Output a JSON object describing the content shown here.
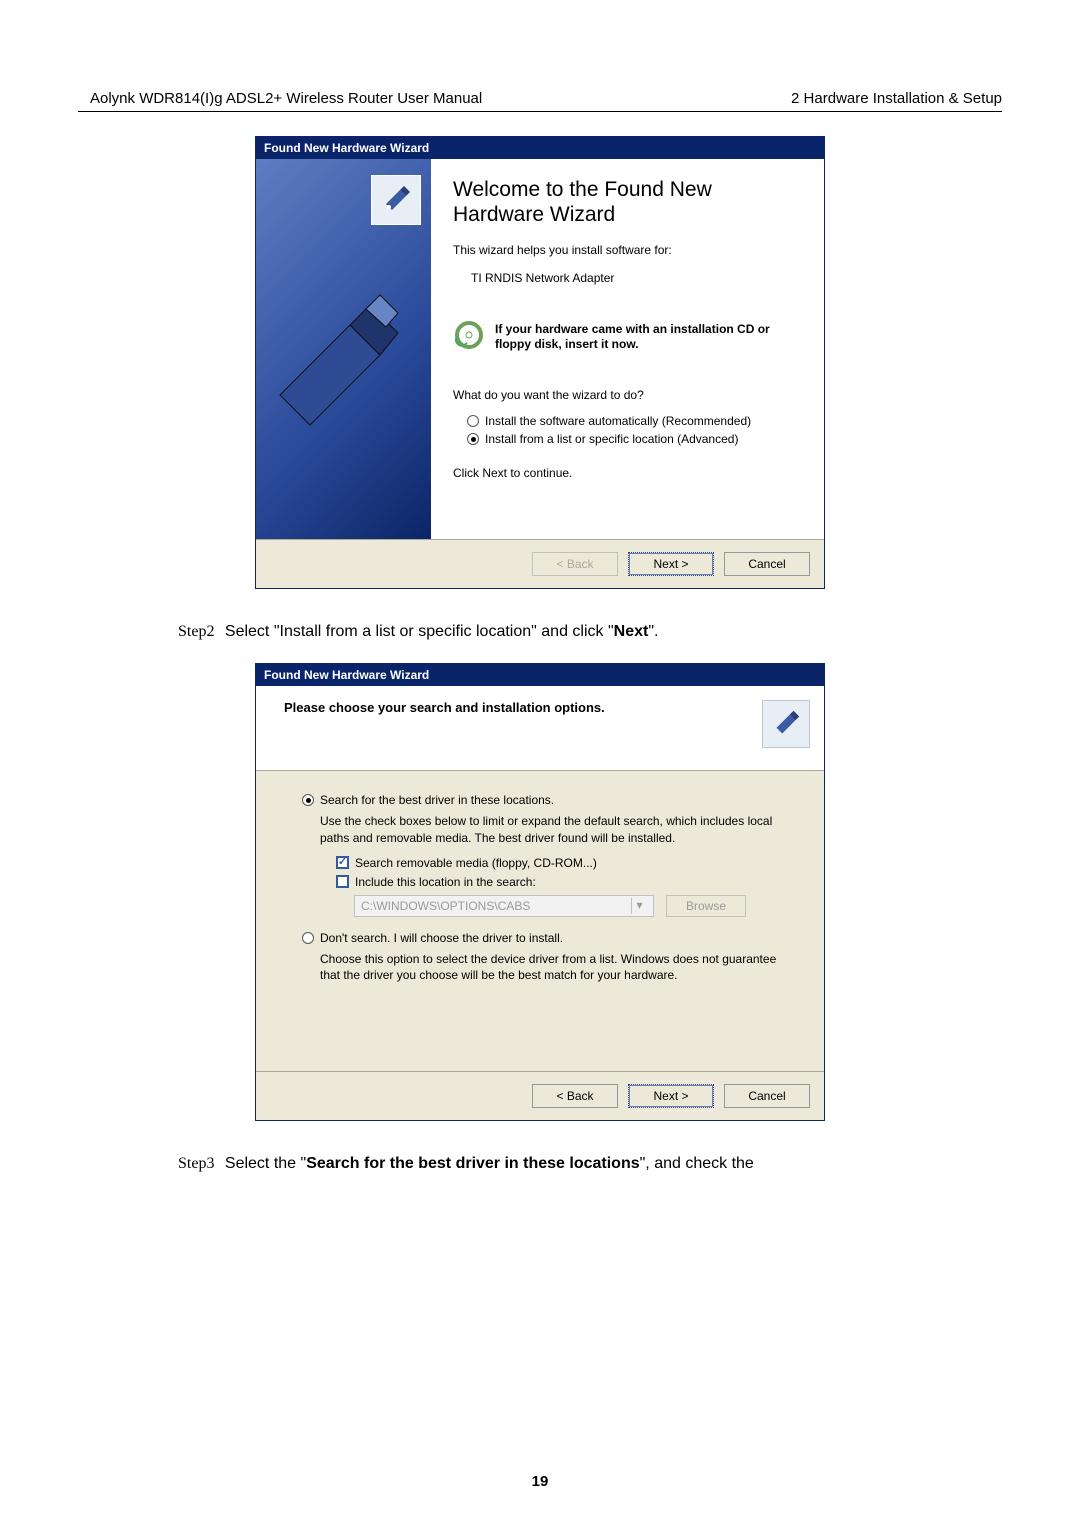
{
  "header": {
    "left": "Aolynk WDR814(I)g ADSL2+ Wireless Router User Manual",
    "right": "2 Hardware Installation & Setup"
  },
  "wizard1": {
    "caption": "Found New Hardware Wizard",
    "welcome": "Welcome to the Found New Hardware Wizard",
    "help": "This wizard helps you install software for:",
    "device": "TI RNDIS Network Adapter",
    "cd": "If your hardware came with an installation CD or floppy disk, insert it now.",
    "question": "What do you want the wizard to do?",
    "radios": [
      "Install the software automatically (Recommended)",
      "Install from a list or specific location (Advanced)"
    ],
    "continue": "Click Next to continue.",
    "buttons": {
      "back": "< Back",
      "next": "Next >",
      "cancel": "Cancel"
    }
  },
  "step2": {
    "label": "Step2",
    "pre": "Select \"",
    "mid": "Install from a list or specific location",
    "post": "\" and click \"",
    "bold": "Next",
    "end": "\"."
  },
  "wizard2": {
    "caption": "Found New Hardware Wizard",
    "heading": "Please choose your search and installation options.",
    "opt1": {
      "label": "Search for the best driver in these locations.",
      "desc": "Use the check boxes below to limit or expand the default search, which includes local paths and removable media. The best driver found will be installed.",
      "chk1": "Search removable media (floppy, CD-ROM...)",
      "chk2": "Include this location in the search:",
      "path": "C:\\WINDOWS\\OPTIONS\\CABS",
      "browse": "Browse"
    },
    "opt2": {
      "label": "Don't search. I will choose the driver to install.",
      "desc": "Choose this option to select the device driver from a list.  Windows does not guarantee that the driver you choose will be the best match for your hardware."
    },
    "buttons": {
      "back": "< Back",
      "next": "Next >",
      "cancel": "Cancel"
    }
  },
  "step3": {
    "label": "Step3",
    "pre": "Select the \"",
    "bold": "Search for the best driver in these locations",
    "post": "\", and check the"
  },
  "page_number": "19"
}
